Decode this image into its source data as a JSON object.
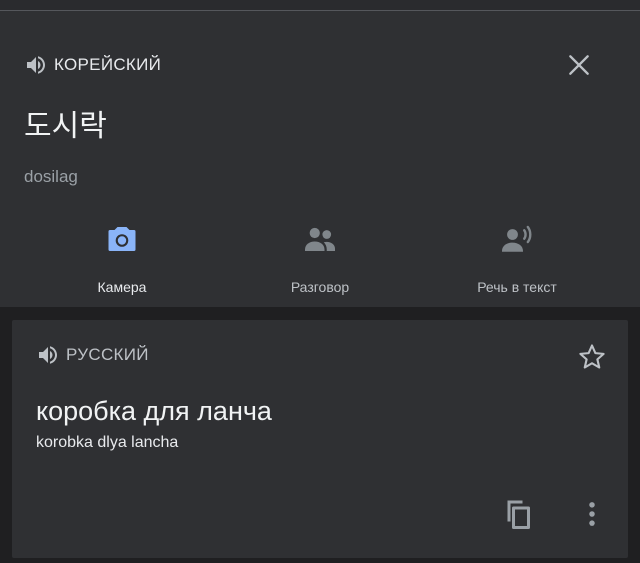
{
  "source": {
    "language": "КОРЕЙСКИЙ",
    "text": "도시락",
    "transliteration": "dosilag"
  },
  "actions": [
    {
      "label": "Камера",
      "icon": "camera-icon",
      "color": "#8ab4f8"
    },
    {
      "label": "Разговор",
      "icon": "people-icon",
      "color": "#80868b"
    },
    {
      "label": "Речь в текст",
      "icon": "voice-speaker-icon",
      "color": "#80868b"
    }
  ],
  "result": {
    "language": "РУССКИЙ",
    "text": "коробка для ланча",
    "transliteration": "korobka dlya lancha"
  },
  "icons": {
    "close": "close-icon",
    "star": "star-outline-icon",
    "copy": "copy-icon",
    "more": "more-vertical-icon",
    "speaker": "speaker-icon"
  },
  "colors": {
    "background": "#1f1f21",
    "panel": "#2f3033",
    "accent": "#8ab4f8",
    "icon_gray": "#80868b"
  }
}
